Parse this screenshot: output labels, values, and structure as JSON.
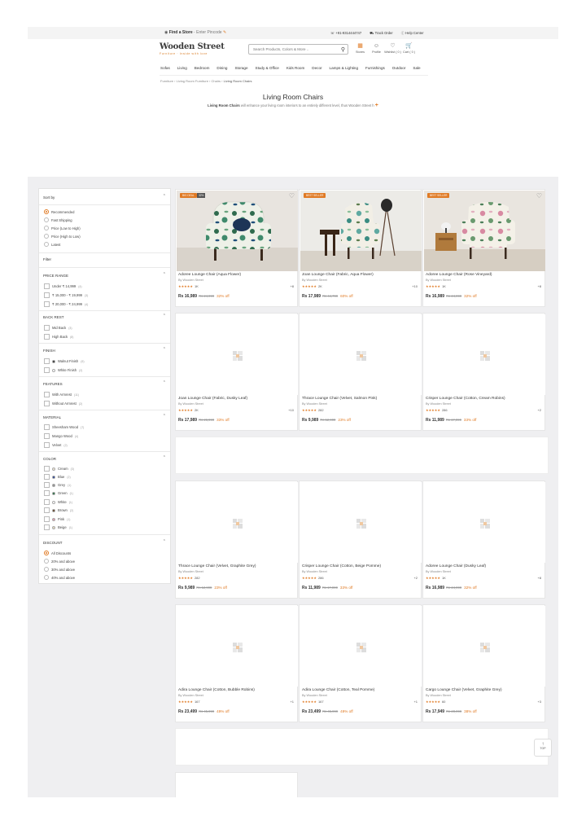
{
  "topbar": {
    "store_label": "Find a Store",
    "pincode_label": "Enter Pincode",
    "phone": "+91-9314444747",
    "track_order": "Track Order",
    "help_center": "Help Center"
  },
  "header": {
    "logo_name": "Wooden Street",
    "logo_tag": "Furniture · Inside with love",
    "search_placeholder": "Search Products, Colors & More ..",
    "icons": [
      {
        "label": "Stores",
        "icon": "store-icon"
      },
      {
        "label": "Profile",
        "icon": "profile-icon"
      },
      {
        "label": "Wishlist ( 0 )",
        "icon": "heart-icon"
      },
      {
        "label": "Cart ( 0 )",
        "icon": "cart-icon"
      }
    ]
  },
  "nav": [
    "Sofas",
    "Living",
    "Bedroom",
    "Dining",
    "Storage",
    "Study & Office",
    "Kids Room",
    "Decor",
    "Lamps & Lighting",
    "Furnishings",
    "Outdoor",
    "Sale"
  ],
  "breadcrumb": {
    "items": [
      "Furniture",
      "Living Room Furniture",
      "Chairs"
    ],
    "current": "Living Room Chairs"
  },
  "page": {
    "title": "Living Room Chairs",
    "desc_bold": "Living Room Chairs",
    "desc_rest": " will enhance your living room interiors to an entirely different level, thus Wooden Street h"
  },
  "sidebar": {
    "sort_title": "Sort by",
    "sort_options": [
      "Recommended",
      "Fast Shipping",
      "Price (Low to High)",
      "Price (High to Low)",
      "Latest"
    ],
    "filter_title": "Filter",
    "price": {
      "title": "PRICE RANGE",
      "options": [
        {
          "label": "Under ₹ 14,999",
          "count": "(4)"
        },
        {
          "label": "₹ 15,000 - ₹ 19,999",
          "count": "(3)"
        },
        {
          "label": "₹ 20,000 - ₹ 24,999",
          "count": "(4)"
        }
      ]
    },
    "backrest": {
      "title": "BACK REST",
      "options": [
        {
          "label": "Mid Back",
          "count": "(3)"
        },
        {
          "label": "High Back",
          "count": "(8)"
        }
      ]
    },
    "finish": {
      "title": "FINISH",
      "options": [
        {
          "label": "Walnut Finish",
          "count": "(9)",
          "color": "#2b2b2b"
        },
        {
          "label": "White Finish",
          "count": "(2)",
          "color": "#ffffff"
        }
      ]
    },
    "features": {
      "title": "FEATURES",
      "options": [
        {
          "label": "With Armrest",
          "count": "(11)"
        },
        {
          "label": "Without Armrest",
          "count": "(2)"
        }
      ]
    },
    "material": {
      "title": "MATERIAL",
      "options": [
        {
          "label": "Sheesham Wood",
          "count": "(7)"
        },
        {
          "label": "Mango Wood",
          "count": "(4)"
        },
        {
          "label": "Velvet",
          "count": "(2)"
        }
      ]
    },
    "color": {
      "title": "COLOR",
      "options": [
        {
          "label": "Cream",
          "count": "(3)",
          "color": "#f3ead6"
        },
        {
          "label": "Blue",
          "count": "(2)",
          "color": "#1f3a93"
        },
        {
          "label": "Grey",
          "count": "(1)",
          "color": "#8e8e8e"
        },
        {
          "label": "Green",
          "count": "(1)",
          "color": "#1d6b3a"
        },
        {
          "label": "White",
          "count": "(1)",
          "color": "#ffffff"
        },
        {
          "label": "Brown",
          "count": "(2)",
          "color": "#5a3a1e"
        },
        {
          "label": "Pink",
          "count": "(1)",
          "color": "#e69bb0"
        },
        {
          "label": "Beige",
          "count": "(1)",
          "color": "#e8dcc0"
        }
      ]
    },
    "discount": {
      "title": "DISCOUNT",
      "options": [
        "All Discounts",
        "20% and above",
        "30% and above",
        "40% and above"
      ]
    }
  },
  "products": [
    {
      "name": "Adoree Lounge Chair (Aqua Flower)",
      "by": "By Wooden Street",
      "stars": "★★★★★",
      "rating_count": "1K",
      "variants": "+8",
      "price": "Rs 16,989",
      "mrp": "Rs 24,999",
      "off": "32% off",
      "badge": "BIG DEAL",
      "badge2": "32%"
    },
    {
      "name": "Joan Lounge Chair (Fabric, Aqua Flower)",
      "by": "By Wooden Street",
      "stars": "★★★★★",
      "rating_count": "2K",
      "variants": "+10",
      "price": "Rs 17,989",
      "mrp": "Rs 44,799",
      "off": "60% off",
      "badge": "BEST SELLER",
      "badge2": ""
    },
    {
      "name": "Adoree Lounge Chair (Rose Vineyard)",
      "by": "By Wooden Street",
      "stars": "★★★★★",
      "rating_count": "1K",
      "variants": "+8",
      "price": "Rs 16,989",
      "mrp": "Rs 24,999",
      "off": "32% off",
      "badge": "BEST SELLER",
      "badge2": ""
    },
    {
      "name": "Joan Lounge Chair (Fabric, Dusky Leaf)",
      "by": "By Wooden Street",
      "stars": "★★★★★",
      "rating_count": "2K",
      "variants": "+10",
      "price": "Rs 17,989",
      "mrp": "Rs 26,999",
      "off": "33% off",
      "badge": "",
      "badge2": ""
    },
    {
      "name": "Thrace Lounge Chair (Velvet, Salmon Pink)",
      "by": "By Wooden Street",
      "stars": "★★★★★",
      "rating_count": "282",
      "variants": "",
      "price": "Rs 9,989",
      "mrp": "Rs 12,999",
      "off": "23% off",
      "badge": "",
      "badge2": ""
    },
    {
      "name": "Crisper Lounge Chair (Cotton, Cream Robins)",
      "by": "By Wooden Street",
      "stars": "★★★★★",
      "rating_count": "286",
      "variants": "+2",
      "price": "Rs 11,989",
      "mrp": "Rs 17,999",
      "off": "33% off",
      "badge": "",
      "badge2": ""
    },
    {
      "name": "Thrace Lounge Chair (Velvet, Graphite Grey)",
      "by": "By Wooden Street",
      "stars": "★★★★★",
      "rating_count": "282",
      "variants": "",
      "price": "Rs 9,989",
      "mrp": "Rs 12,999",
      "off": "23% off",
      "badge": "",
      "badge2": ""
    },
    {
      "name": "Crisper Lounge Chair (Cotton, Beige Pomme)",
      "by": "By Wooden Street",
      "stars": "★★★★★",
      "rating_count": "286",
      "variants": "+2",
      "price": "Rs 11,989",
      "mrp": "Rs 17,999",
      "off": "33% off",
      "badge": "",
      "badge2": ""
    },
    {
      "name": "Adoree Lounge Chair (Dusky Leaf)",
      "by": "By Wooden Street",
      "stars": "★★★★★",
      "rating_count": "1K",
      "variants": "+8",
      "price": "Rs 16,989",
      "mrp": "Rs 24,999",
      "off": "32% off",
      "badge": "",
      "badge2": ""
    },
    {
      "name": "Adira Lounge Chair (Cotton, Bubble Robins)",
      "by": "By Wooden Street",
      "stars": "★★★★★",
      "rating_count": "167",
      "variants": "+1",
      "price": "Rs 23,499",
      "mrp": "Rs 45,999",
      "off": "49% off",
      "badge": "",
      "badge2": ""
    },
    {
      "name": "Adira Lounge Chair (Cotton, Teal Pomme)",
      "by": "By Wooden Street",
      "stars": "★★★★★",
      "rating_count": "167",
      "variants": "+1",
      "price": "Rs 23,499",
      "mrp": "Rs 45,999",
      "off": "49% off",
      "badge": "",
      "badge2": ""
    },
    {
      "name": "Cargo Lounge Chair (Velvet, Graphite Grey)",
      "by": "By Wooden Street",
      "stars": "★★★★★",
      "rating_count": "60",
      "variants": "+3",
      "price": "Rs 17,949",
      "mrp": "Rs 28,999",
      "off": "38% off",
      "badge": "",
      "badge2": ""
    }
  ],
  "top_button": "TOP",
  "colors": {
    "accent": "#e07a24",
    "gray_bg": "#efeff1"
  }
}
